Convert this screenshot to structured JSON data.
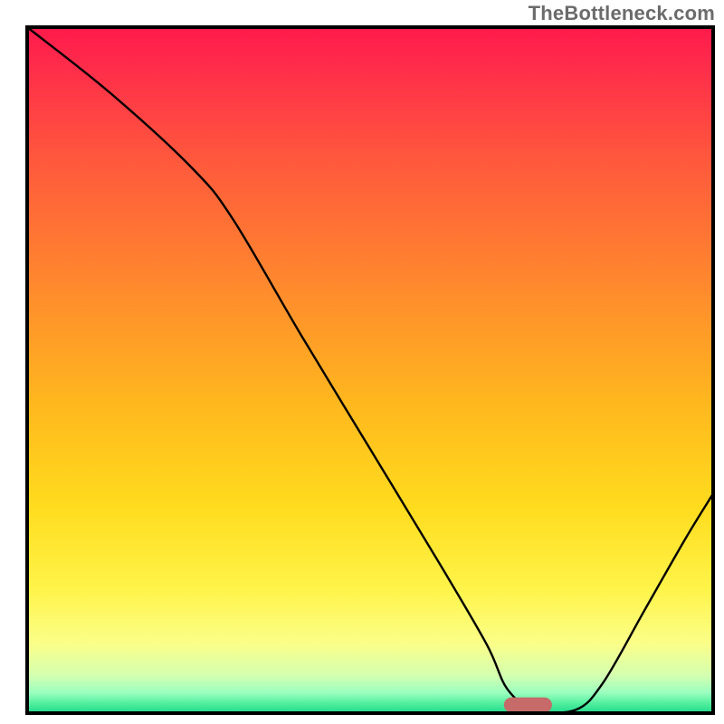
{
  "watermark": "TheBottleneck.com",
  "chart_data": {
    "type": "line",
    "title": "",
    "xlabel": "",
    "ylabel": "",
    "xlim": [
      0,
      100
    ],
    "ylim": [
      0,
      100
    ],
    "grid": false,
    "legend": false,
    "annotations": [],
    "background_gradient": {
      "stops": [
        {
          "offset": 0.0,
          "color": "#ff1a4b"
        },
        {
          "offset": 0.05,
          "color": "#ff2a4b"
        },
        {
          "offset": 0.2,
          "color": "#ff5a3c"
        },
        {
          "offset": 0.38,
          "color": "#ff8a2d"
        },
        {
          "offset": 0.55,
          "color": "#ffb81e"
        },
        {
          "offset": 0.7,
          "color": "#ffdc1e"
        },
        {
          "offset": 0.82,
          "color": "#fff44a"
        },
        {
          "offset": 0.9,
          "color": "#faff8a"
        },
        {
          "offset": 0.945,
          "color": "#d4ffb0"
        },
        {
          "offset": 0.97,
          "color": "#9cffc0"
        },
        {
          "offset": 0.985,
          "color": "#55f0a0"
        },
        {
          "offset": 1.0,
          "color": "#1fd98a"
        }
      ]
    },
    "marker": {
      "x": 73,
      "y": 1.2,
      "width": 7,
      "height": 2.2,
      "rx": 1.2,
      "color": "#c76a6a"
    },
    "series": [
      {
        "name": "curve",
        "color": "#000000",
        "stroke_width": 2.4,
        "x": [
          0,
          12,
          24,
          30,
          40,
          50,
          60,
          67,
          70,
          74,
          80,
          84,
          90,
          96,
          100
        ],
        "y": [
          100,
          90.5,
          79.5,
          72,
          55,
          38.5,
          22,
          10,
          3.5,
          0.5,
          0.5,
          4.5,
          15,
          25.5,
          32
        ]
      }
    ]
  }
}
